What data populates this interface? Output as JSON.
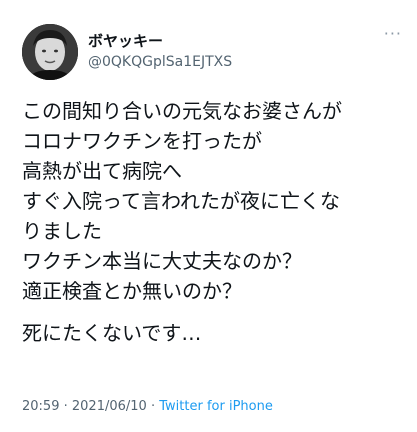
{
  "user": {
    "display_name": "ボヤッキー",
    "handle": "@0QKQGplSa1EJTXS",
    "avatar_icon": "profile-photo"
  },
  "more_icon": "more-options-icon",
  "tweet": {
    "lines": [
      "この間知り合いの元気なお婆さんが",
      "コロナワクチンを打ったが",
      "高熱が出て病院へ",
      "すぐ入院って言われたが夜に亡くな",
      "りました",
      "ワクチン本当に大丈夫なのか？",
      "適正検査とか無いのか？",
      "死にたくないです…"
    ]
  },
  "meta": {
    "time": "20:59",
    "date": "2021/06/10",
    "separator": "·",
    "source": "Twitter for iPhone"
  },
  "colors": {
    "text": "#0f1419",
    "secondary": "#536471",
    "link": "#1d9bf0"
  }
}
